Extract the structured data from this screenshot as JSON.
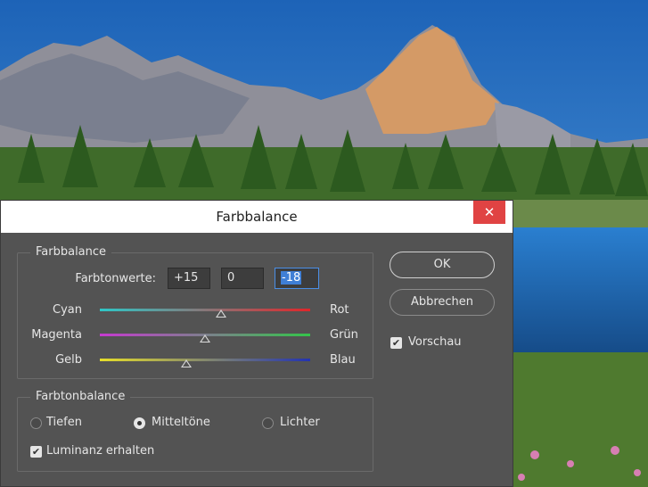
{
  "dialog": {
    "title": "Farbbalance",
    "close_glyph": "✕"
  },
  "color_balance": {
    "group_label": "Farbbalance",
    "values_label": "Farbtonwerte:",
    "values": [
      "+15",
      "0",
      "-18"
    ],
    "sliders": [
      {
        "left": "Cyan",
        "right": "Rot",
        "value": 15,
        "left_color": "#2ec7c7",
        "right_color": "#e0262a"
      },
      {
        "left": "Magenta",
        "right": "Grün",
        "value": 0,
        "left_color": "#c63ad0",
        "right_color": "#34c44a"
      },
      {
        "left": "Gelb",
        "right": "Blau",
        "value": -18,
        "left_color": "#e6de2a",
        "right_color": "#2333b0"
      }
    ],
    "range": [
      -100,
      100
    ]
  },
  "tone_balance": {
    "group_label": "Farbtonbalance",
    "shadows": "Tiefen",
    "midtones": "Mitteltöne",
    "highlights": "Lichter",
    "selected": "midtones",
    "preserve_luminosity": "Luminanz erhalten",
    "preserve_checked": true
  },
  "buttons": {
    "ok": "OK",
    "cancel": "Abbrechen"
  },
  "preview": {
    "label": "Vorschau",
    "checked": true
  },
  "icons": {
    "close": "close-icon",
    "check": "checkmark-icon",
    "thumb": "slider-thumb-icon"
  },
  "colors": {
    "dialog_bg": "#535353",
    "close_bg": "#e04343",
    "focus": "#4a8ee6"
  }
}
